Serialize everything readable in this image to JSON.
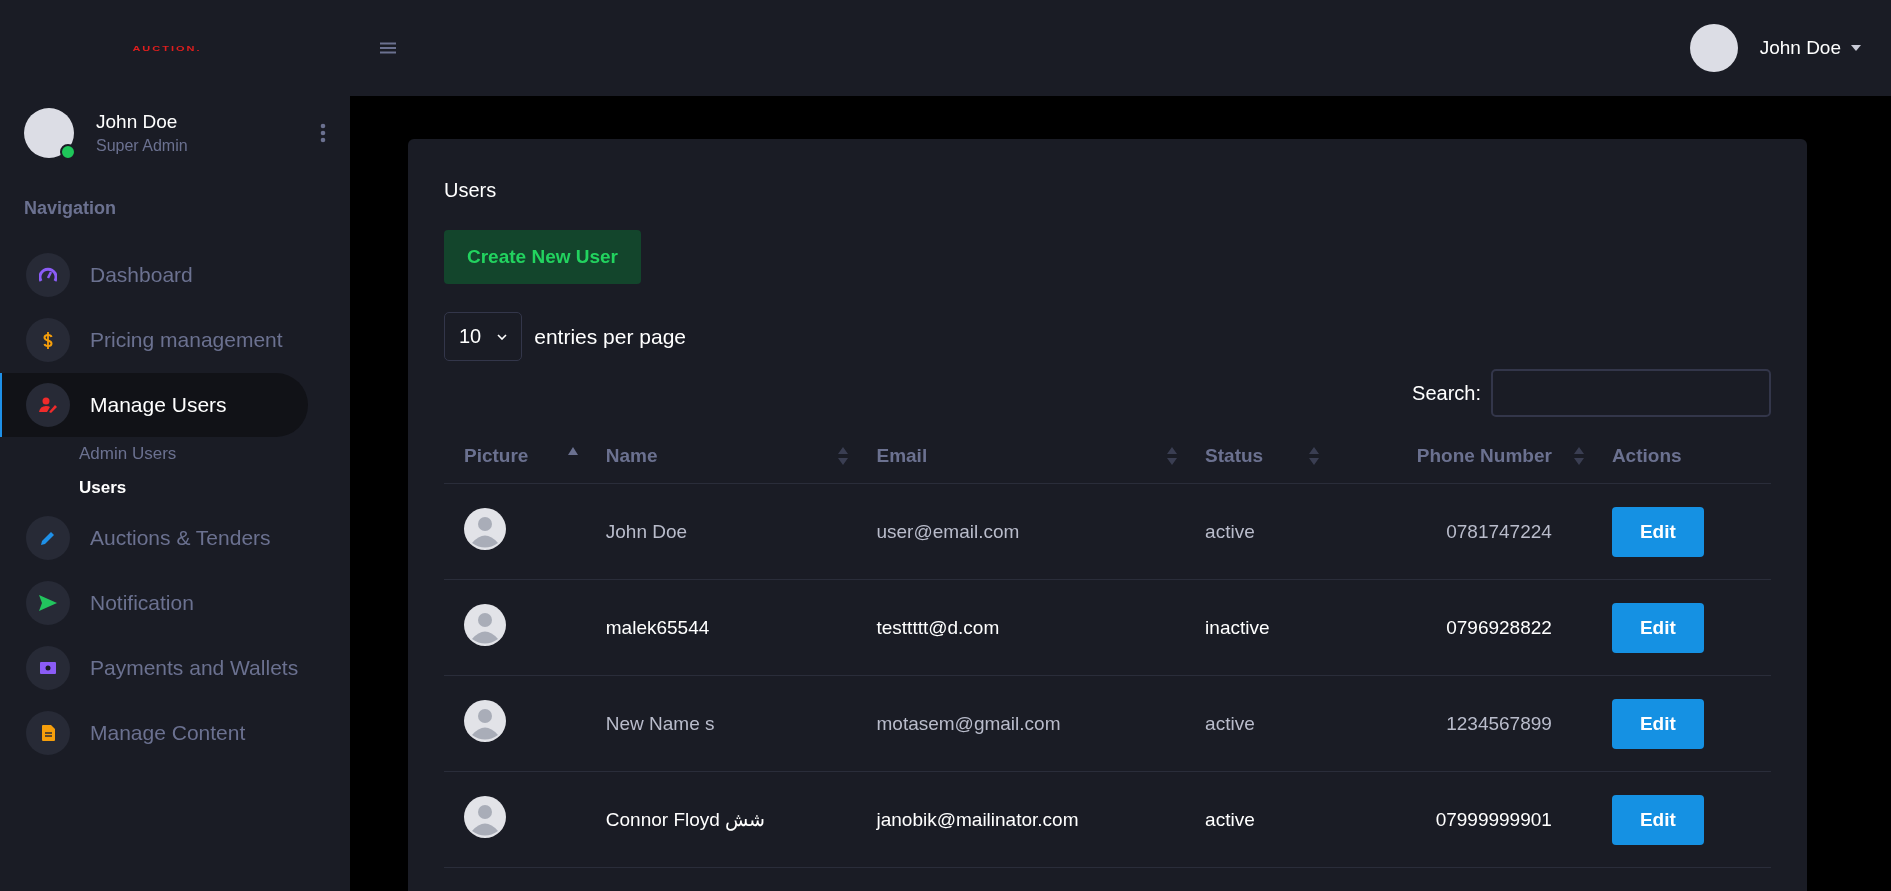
{
  "brand": {
    "logo": "AUCTION."
  },
  "topbar": {
    "user_name": "John Doe"
  },
  "sidebar": {
    "user": {
      "name": "John Doe",
      "role": "Super Admin",
      "online": true
    },
    "section_title": "Navigation",
    "items": [
      {
        "label": "Dashboard",
        "kind": "gauge",
        "selected": false
      },
      {
        "label": "Pricing management",
        "kind": "dollar",
        "selected": false
      },
      {
        "label": "Manage Users",
        "kind": "user",
        "selected": true,
        "children": [
          {
            "label": "Admin Users",
            "selected": false
          },
          {
            "label": "Users",
            "selected": true
          }
        ]
      },
      {
        "label": "Auctions & Tenders",
        "kind": "pencil",
        "selected": false
      },
      {
        "label": "Notification",
        "kind": "send",
        "selected": false
      },
      {
        "label": "Payments and Wallets",
        "kind": "money",
        "selected": false
      },
      {
        "label": "Manage Content",
        "kind": "file",
        "selected": false
      }
    ]
  },
  "card": {
    "title": "Users",
    "create_button": "Create New User",
    "page_size": "10",
    "page_size_label": "entries per page",
    "search_label": "Search:"
  },
  "table": {
    "columns": [
      {
        "label": "Picture"
      },
      {
        "label": "Name"
      },
      {
        "label": "Email"
      },
      {
        "label": "Status"
      },
      {
        "label": "Phone Number"
      },
      {
        "label": "Actions"
      }
    ],
    "rows": [
      {
        "name": "John Doe",
        "email": "user@email.com",
        "status": "active",
        "phone": "0781747224",
        "action": "Edit",
        "bright": false
      },
      {
        "name": "malek65544",
        "email": "testtttt@d.com",
        "status": "inactive",
        "phone": "0796928822",
        "action": "Edit",
        "bright": true
      },
      {
        "name": "New Name s",
        "email": "motasem@gmail.com",
        "status": "active",
        "phone": "1234567899",
        "action": "Edit",
        "bright": false
      },
      {
        "name": "Connor Floyd شش",
        "email": "janobik@mailinator.com",
        "status": "active",
        "phone": "07999999901",
        "action": "Edit",
        "bright": true
      }
    ]
  }
}
